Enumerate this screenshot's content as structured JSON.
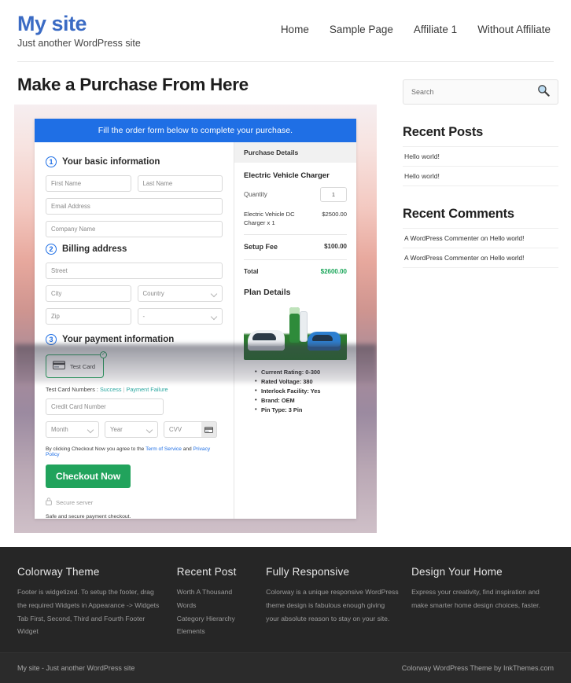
{
  "header": {
    "site_title": "My site",
    "tagline": "Just another WordPress site",
    "nav": [
      {
        "label": "Home"
      },
      {
        "label": "Sample Page"
      },
      {
        "label": "Affiliate 1"
      },
      {
        "label": "Without Affiliate"
      }
    ]
  },
  "main": {
    "page_title": "Make a Purchase From Here",
    "order_banner": "Fill the order form below to complete your purchase.",
    "step1": {
      "number": "1",
      "label": "Your basic information",
      "first_name_placeholder": "First Name",
      "last_name_placeholder": "Last Name",
      "email_placeholder": "Email Address",
      "company_placeholder": "Company Name"
    },
    "step2": {
      "number": "2",
      "label": "Billing address",
      "street_placeholder": "Street",
      "city_placeholder": "City",
      "country_placeholder": "Country",
      "zip_placeholder": "Zip",
      "state_placeholder": "-"
    },
    "step3": {
      "number": "3",
      "label": "Your payment information",
      "card_option_label": "Test Card",
      "check_mark": "✓",
      "test_cards_prefix": "Test Card Numbers : ",
      "test_cards_success": "Success",
      "test_cards_separator": " | ",
      "test_cards_failure": "Payment Failure",
      "cc_placeholder": "Credit Card Number",
      "month_placeholder": "Month",
      "year_placeholder": "Year",
      "cvv_placeholder": "CVV",
      "terms_prefix": "By clicking Checkout Now you agree to the ",
      "terms_link1": "Term of Service",
      "terms_mid": " and ",
      "terms_link2": "Privacy Policy",
      "checkout_label": "Checkout Now",
      "secure_server": "Secure server",
      "secure_note": "Safe and secure payment checkout."
    },
    "summary": {
      "heading": "Purchase Details",
      "product_name": "Electric Vehicle Charger",
      "quantity_label": "Quantity",
      "quantity_value": "1",
      "line_item_name": "Electric Vehicle DC Charger x 1",
      "line_item_amount": "$2500.00",
      "setup_fee_label": "Setup Fee",
      "setup_fee_amount": "$100.00",
      "total_label": "Total",
      "total_amount": "$2600.00",
      "total_color": "#18a558"
    },
    "plan": {
      "title": "Plan Details",
      "specs": [
        "Current Rating: 0-300",
        "Rated Voltage: 380",
        "Interlock Facility: Yes",
        "Brand: OEM",
        "Pin Type: 3 Pin"
      ]
    }
  },
  "sidebar": {
    "search_placeholder": "Search",
    "recent_posts_title": "Recent Posts",
    "recent_posts": [
      {
        "label": "Hello world!"
      },
      {
        "label": "Hello world!"
      }
    ],
    "recent_comments_title": "Recent Comments",
    "recent_comments": [
      {
        "label": "A WordPress Commenter on Hello world!"
      },
      {
        "label": "A WordPress Commenter on Hello world!"
      }
    ]
  },
  "footer": {
    "columns": [
      {
        "title": "Colorway Theme",
        "text": "Footer is widgetized. To setup the footer, drag the required Widgets in Appearance -> Widgets Tab First, Second, Third and Fourth Footer Widget",
        "items": []
      },
      {
        "title": "Recent Post",
        "text": "",
        "items": [
          {
            "label": "Worth A Thousand Words"
          },
          {
            "label": "Category Hierarchy"
          },
          {
            "label": "Elements"
          }
        ]
      },
      {
        "title": "Fully Responsive",
        "text": "Colorway is a unique responsive WordPress theme design is fabulous enough giving your absolute reason to stay on your site.",
        "items": []
      },
      {
        "title": "Design Your Home",
        "text": "Express your creativity, find inspiration and make smarter home design choices, faster.",
        "items": []
      }
    ],
    "bottom_left": "My site - Just another WordPress site",
    "bottom_right": "Colorway WordPress Theme by InkThemes.com"
  },
  "theme": {
    "accent_blue": "#1f6fe5",
    "brand_blue": "#3b6bc4",
    "accent_green": "#21a35c",
    "footer_bg": "#262626"
  }
}
